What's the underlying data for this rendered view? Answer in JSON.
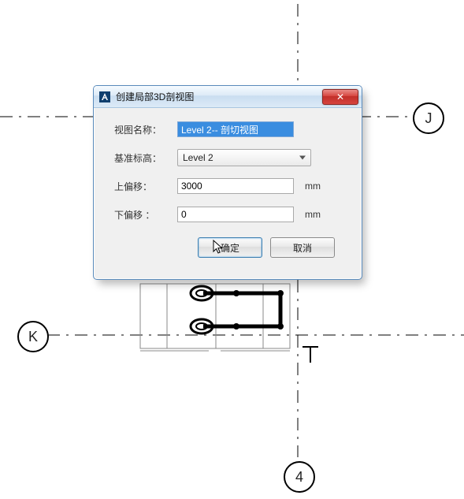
{
  "dialog": {
    "title": "创建局部3D剖视图",
    "labels": {
      "view_name": "视图名称：",
      "base_level": "基准标高：",
      "top_offset": "上偏移：",
      "bottom_offset": "下偏移  ："
    },
    "values": {
      "view_name": "Level 2-- 剖切视图",
      "base_level": "Level 2",
      "top_offset": "3000",
      "bottom_offset": "0"
    },
    "units": {
      "top_offset": "mm",
      "bottom_offset": "mm"
    },
    "buttons": {
      "ok": "确定",
      "cancel": "取消"
    },
    "close_glyph": "✕"
  },
  "grids": {
    "J": "J",
    "K": "K",
    "four": "4"
  }
}
